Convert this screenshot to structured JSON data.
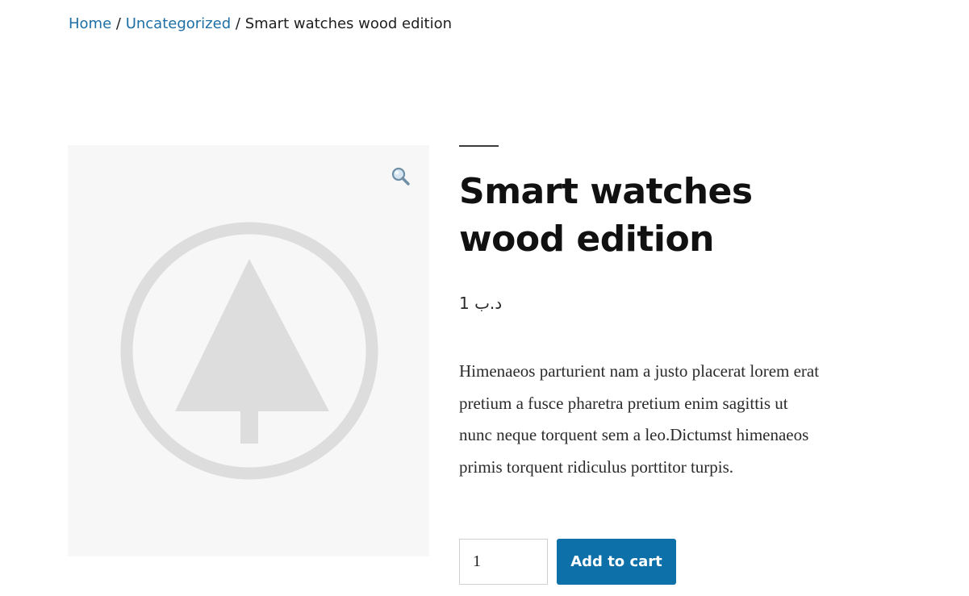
{
  "breadcrumb": {
    "home": "Home",
    "separator": "/",
    "category": "Uncategorized",
    "current": "Smart watches wood edition"
  },
  "product": {
    "title": "Smart watches wood edition",
    "price": "د.ب 1",
    "description": "Himenaeos parturient nam a justo placerat lorem erat pretium a fusce pharetra pretium enim sagittis ut nunc neque torquent sem a leo.Dictumst himenaeos primis torquent ridiculus porttitor turpis."
  },
  "gallery": {
    "zoom_icon": "magnifier-icon",
    "placeholder_icon": "tree-placeholder-icon"
  },
  "cart": {
    "quantity": "1",
    "add_label": "Add to cart"
  },
  "colors": {
    "link": "#1d6fa5",
    "button": "#0e70a8",
    "gallery_bg": "#f7f7f7",
    "placeholder": "#dddddd"
  }
}
